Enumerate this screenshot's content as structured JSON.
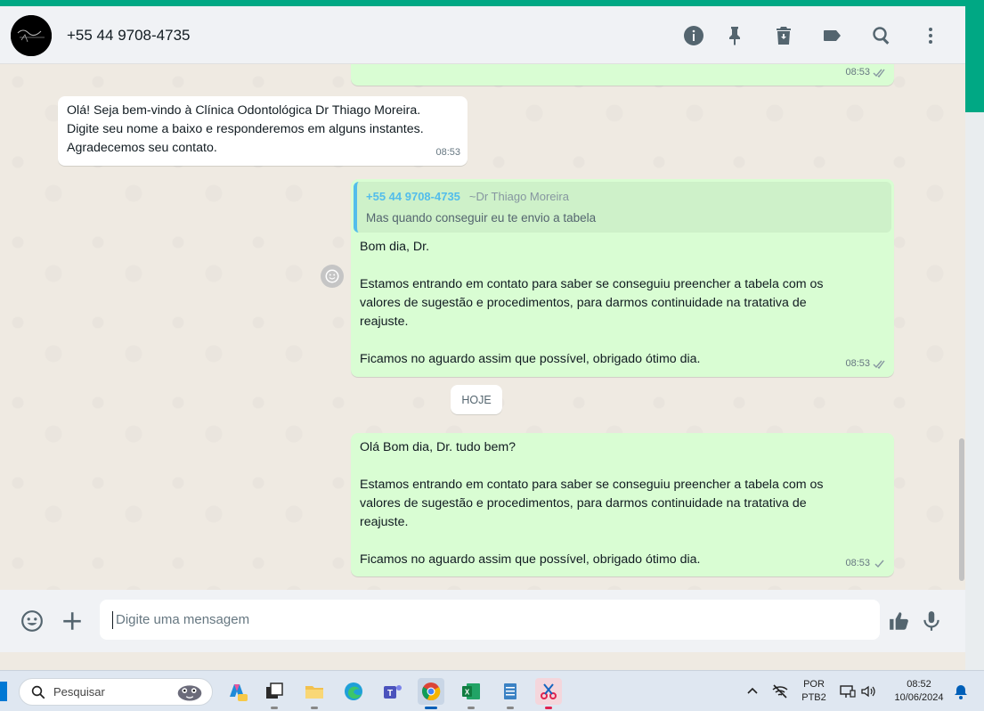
{
  "header": {
    "contact_name": "+55 44 9708-4735",
    "icons": [
      "info-icon",
      "pin-icon",
      "delete-icon",
      "label-icon",
      "search-icon",
      "menu-icon"
    ]
  },
  "messages": {
    "prev_time": "08:53",
    "welcome": {
      "text": "Olá! Seja bem-vindo à Clínica Odontológica Dr Thiago Moreira.\n Digite seu nome a baixo e responderemos em alguns instantes.\nAgradecemos seu contato.",
      "time": "08:53"
    },
    "reply": {
      "quote_author": "+55 44 9708-4735",
      "quote_sub": "~Dr Thiago Moreira",
      "quote_text": "Mas quando conseguir eu te envio a tabela",
      "text": "Bom dia, Dr.\n\nEstamos entrando em contato para saber se conseguiu preencher a tabela com os\nvalores de sugestão e procedimentos, para darmos continuidade na tratativa de\nreajuste.\n\nFicamos no aguardo assim que possível, obrigado ótimo dia.",
      "time": "08:53",
      "status": "read"
    },
    "date_divider": "HOJE",
    "today": {
      "text": "Olá Bom dia, Dr. tudo bem?\n\nEstamos entrando em contato para saber se conseguiu preencher a tabela com os\nvalores de sugestão e procedimentos, para darmos continuidade na tratativa de\nreajuste.\n\nFicamos no aguardo assim que possível, obrigado ótimo dia.",
      "time": "08:53",
      "status": "sent"
    }
  },
  "composer": {
    "placeholder": "Digite uma mensagem"
  },
  "taskbar": {
    "search_label": "Pesquisar",
    "lang_line1": "POR",
    "lang_line2": "PTB2",
    "clock_time": "08:52",
    "clock_date": "10/06/2024"
  },
  "colors": {
    "accent": "#00a884",
    "outgoing_bubble": "#d9fdd3",
    "incoming_bubble": "#ffffff",
    "read_ticks": "#53bdeb"
  }
}
